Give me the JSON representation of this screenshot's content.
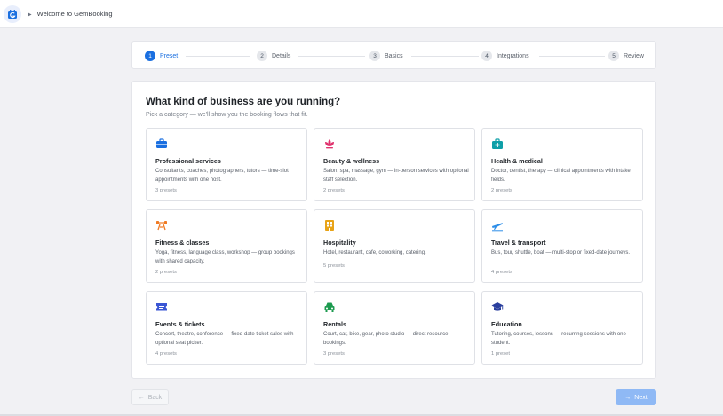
{
  "topbar": {
    "title": "Welcome to GemBooking",
    "arrow": "▶"
  },
  "stepper": {
    "steps": [
      {
        "num": "1",
        "label": "Preset",
        "active": true
      },
      {
        "num": "2",
        "label": "Details",
        "active": false
      },
      {
        "num": "3",
        "label": "Basics",
        "active": false
      },
      {
        "num": "4",
        "label": "Integrations",
        "active": false
      },
      {
        "num": "5",
        "label": "Review",
        "active": false
      }
    ]
  },
  "main": {
    "title": "What kind of business are you running?",
    "subtitle": "Pick a category — we'll show you the booking flows that fit.",
    "categories": [
      {
        "icon": "briefcase-icon",
        "color": "#1a6fe0",
        "title": "Professional services",
        "desc": "Consultants, coaches, photographers, tutors — time-slot appointments with one host.",
        "count": "3 presets"
      },
      {
        "icon": "lotus-icon",
        "color": "#e0336e",
        "title": "Beauty & wellness",
        "desc": "Salon, spa, massage, gym — in-person services with optional staff selection.",
        "count": "2 presets"
      },
      {
        "icon": "medical-kit-icon",
        "color": "#0e9fa8",
        "title": "Health & medical",
        "desc": "Doctor, dentist, therapy — clinical appointments with intake fields.",
        "count": "2 presets"
      },
      {
        "icon": "dumbbell-icon",
        "color": "#f07b24",
        "title": "Fitness & classes",
        "desc": "Yoga, fitness, language class, workshop — group bookings with shared capacity.",
        "count": "2 presets"
      },
      {
        "icon": "hotel-icon",
        "color": "#e8a317",
        "title": "Hospitality",
        "desc": "Hotel, restaurant, cafe, coworking, catering.",
        "count": "5 presets"
      },
      {
        "icon": "airplane-icon",
        "color": "#2f8fe8",
        "title": "Travel & transport",
        "desc": "Bus, tour, shuttle, boat — multi-stop or fixed-date journeys.",
        "count": "4 presets"
      },
      {
        "icon": "ticket-icon",
        "color": "#3a56d4",
        "title": "Events & tickets",
        "desc": "Concert, theatre, conference — fixed-date ticket sales with optional seat picker.",
        "count": "4 presets"
      },
      {
        "icon": "car-icon",
        "color": "#1c9a4f",
        "title": "Rentals",
        "desc": "Court, car, bike, gear, photo studio — direct resource bookings.",
        "count": "3 presets"
      },
      {
        "icon": "graduation-cap-icon",
        "color": "#2a3f9e",
        "title": "Education",
        "desc": "Tutoring, courses, lessons — recurring sessions with one student.",
        "count": "1 preset"
      }
    ]
  },
  "footer": {
    "back_label": "Back",
    "next_label": "Next"
  }
}
